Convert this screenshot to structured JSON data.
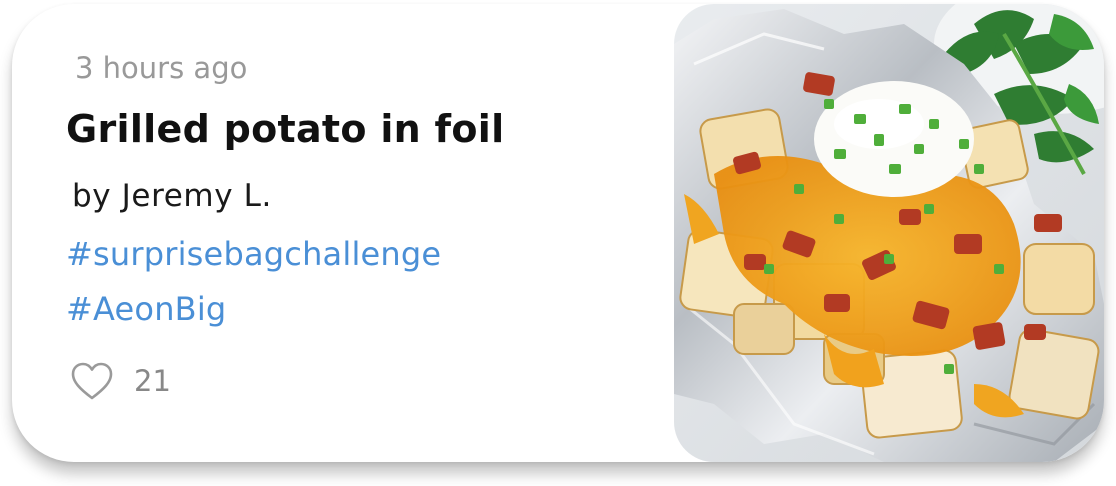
{
  "post": {
    "time_ago": "3 hours ago",
    "title": "Grilled potato in foil",
    "author": "by Jeremy L.",
    "hashtags": [
      "#surprisebagchallenge",
      "#AeonBig"
    ],
    "likes": {
      "icon": "heart-outline-icon",
      "count": "21"
    }
  },
  "colors": {
    "hashtag": "#4a8fd6",
    "muted_text": "#999999",
    "title_text": "#111111"
  }
}
